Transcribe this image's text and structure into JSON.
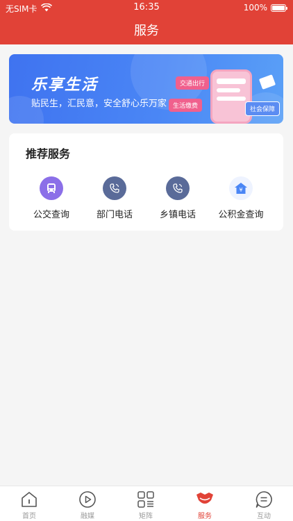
{
  "status": {
    "carrier": "无SIM卡",
    "time": "16:35",
    "battery": "100%"
  },
  "header": {
    "title": "服务"
  },
  "banner": {
    "title": "乐享生活",
    "subtitle": "贴民生，汇民意，安全舒心乐万家",
    "tags": [
      "交通出行",
      "生活缴费",
      "社会保障"
    ]
  },
  "recommend": {
    "title": "推荐服务",
    "items": [
      {
        "label": "公交查询",
        "icon": "bus-icon"
      },
      {
        "label": "部门电话",
        "icon": "phone-icon"
      },
      {
        "label": "乡镇电话",
        "icon": "phone-icon"
      },
      {
        "label": "公积金查询",
        "icon": "house-fund-icon"
      }
    ]
  },
  "tabbar": {
    "items": [
      {
        "label": "首页",
        "icon": "home-icon",
        "active": false
      },
      {
        "label": "融媒",
        "icon": "play-icon",
        "active": false
      },
      {
        "label": "矩阵",
        "icon": "grid-icon",
        "active": false
      },
      {
        "label": "服务",
        "icon": "service-icon",
        "active": true
      },
      {
        "label": "互动",
        "icon": "chat-icon",
        "active": false
      }
    ]
  },
  "colors": {
    "brand": "#e14237",
    "bannerBlue": "#4a86f5",
    "busPurple": "#8b6fe8",
    "phoneSlate": "#5a6b99",
    "fundBlue": "#4a86f5"
  }
}
